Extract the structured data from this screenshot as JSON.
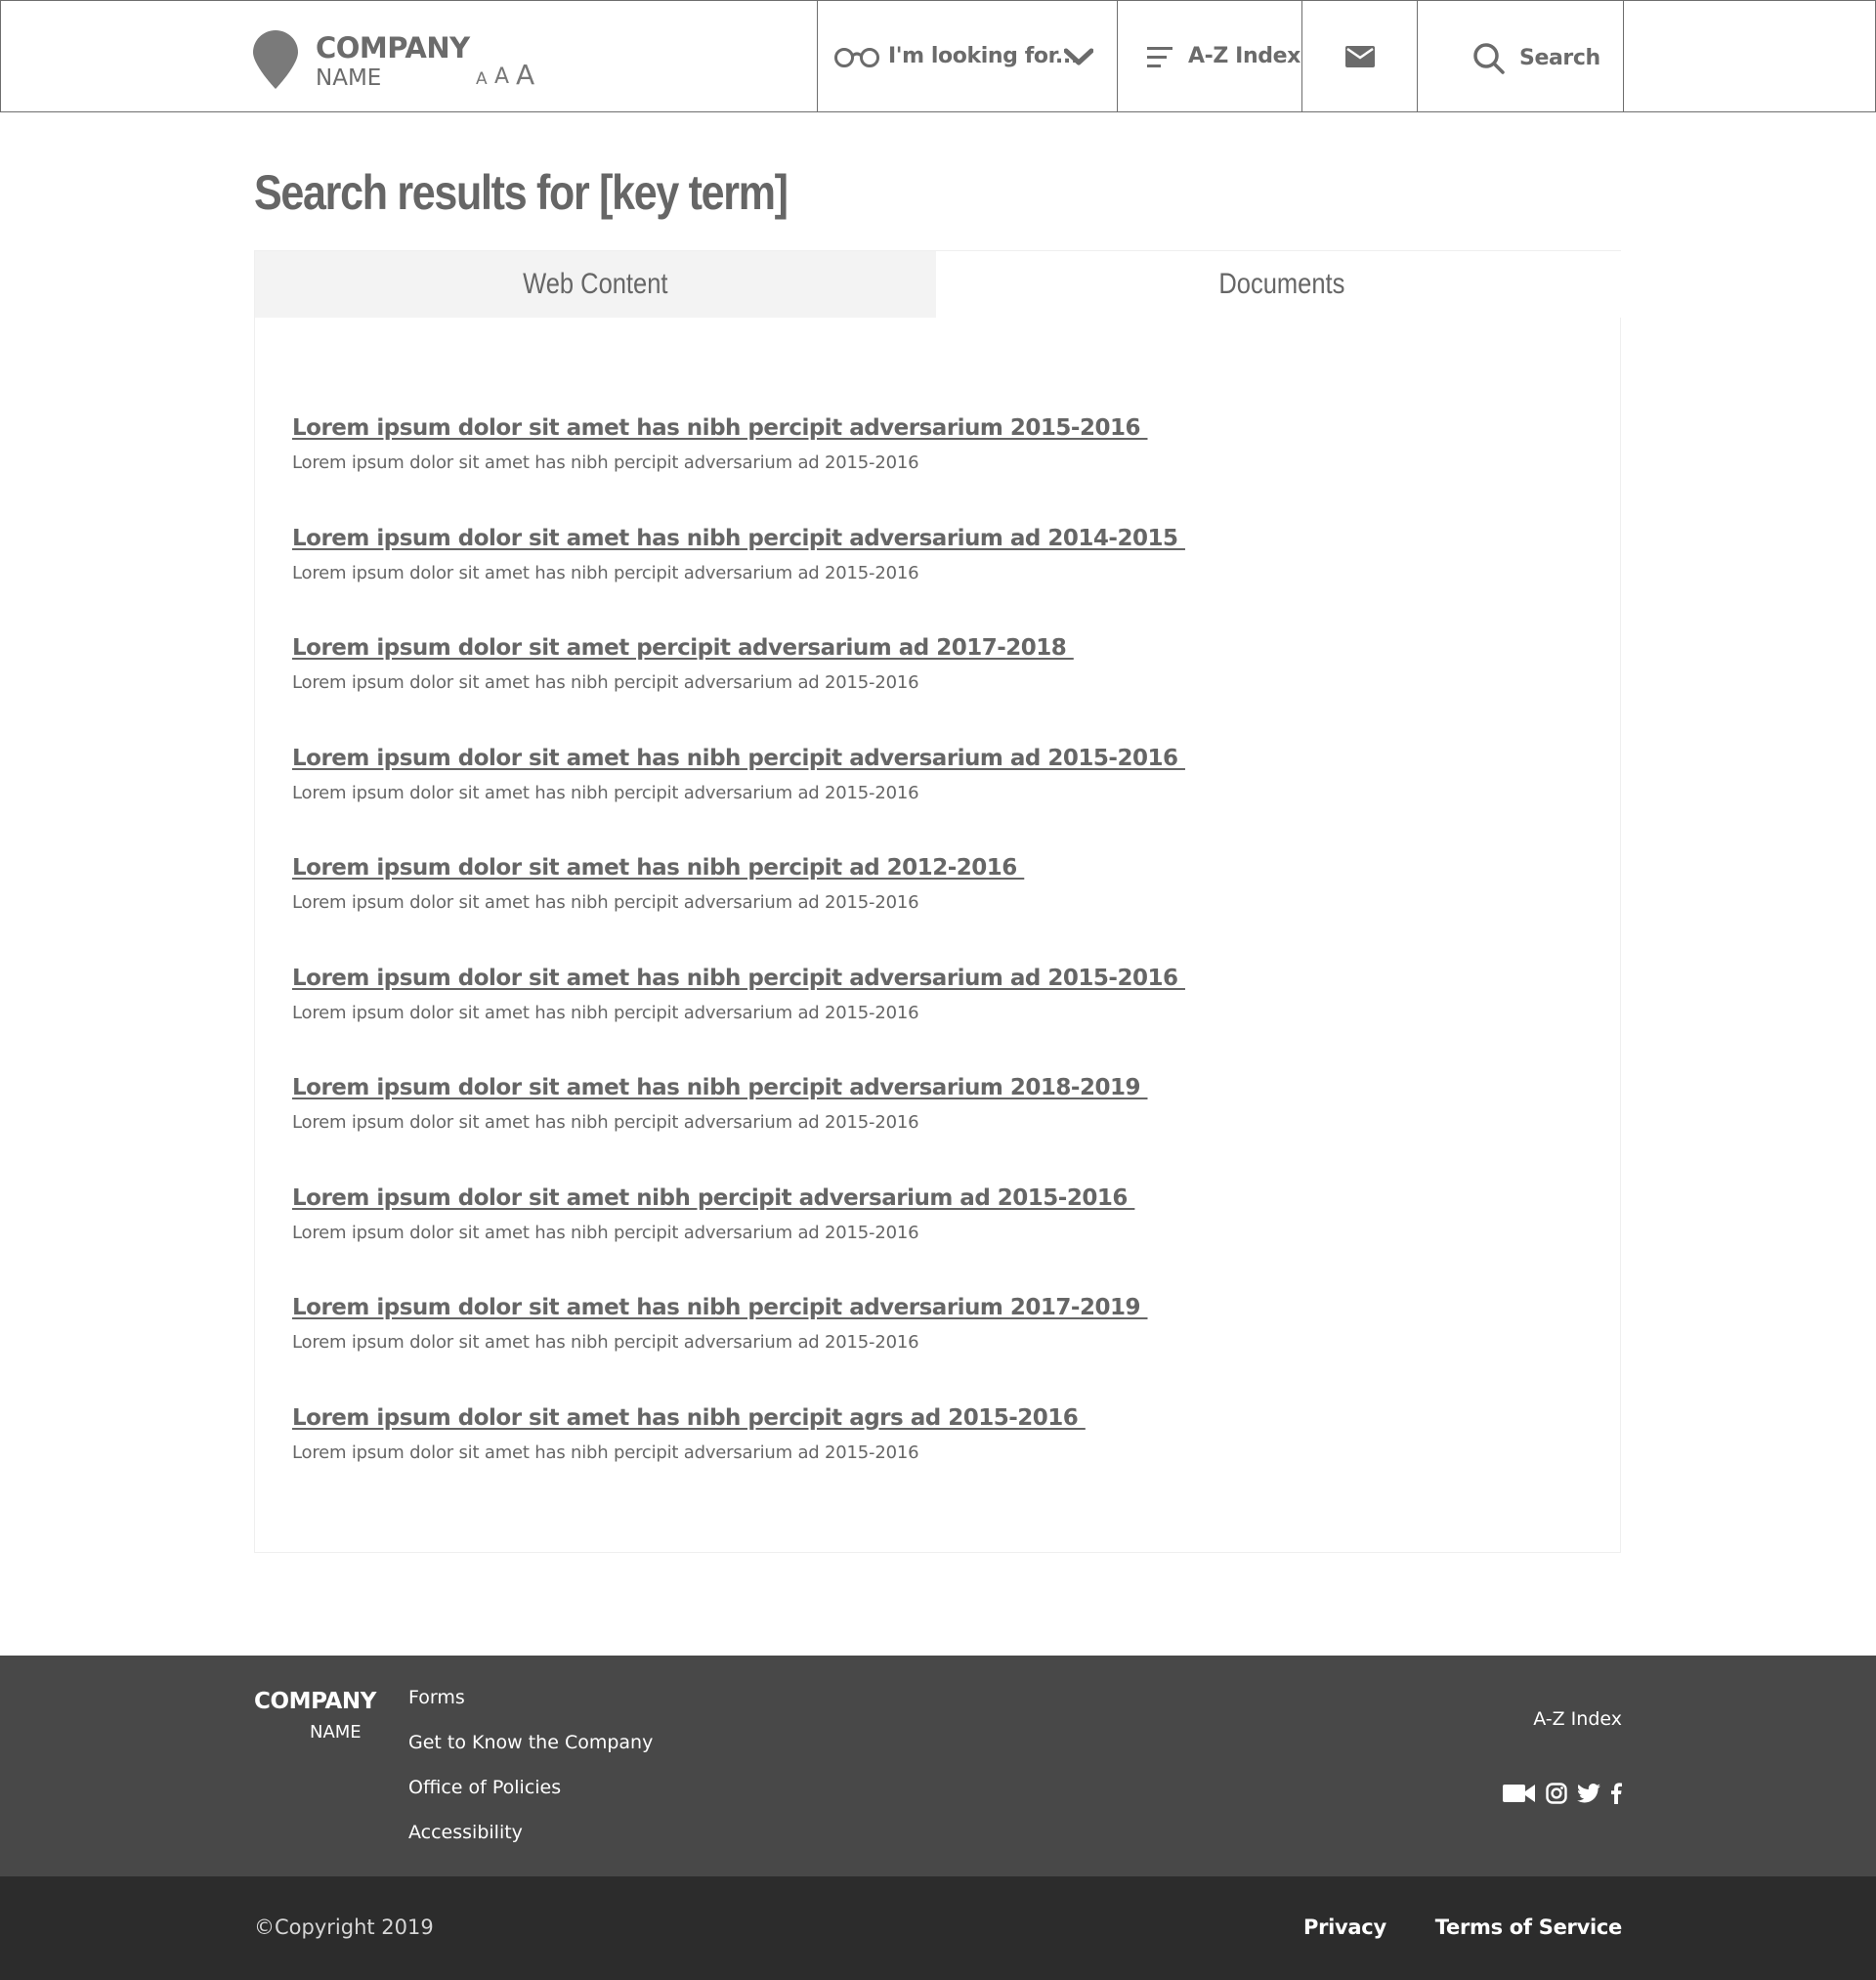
{
  "header": {
    "logo": {
      "company": "COMPANY",
      "name": "NAME"
    },
    "text_size": {
      "small": "A",
      "medium": "A",
      "large": "A"
    },
    "looking_for": {
      "label": "I'm looking for...",
      "icon": "glasses-icon"
    },
    "az_index": {
      "label": "A-Z Index",
      "icon": "menu-lines-icon"
    },
    "mail": {
      "icon": "envelope-icon"
    },
    "search": {
      "label": "Search",
      "icon": "search-icon"
    }
  },
  "main": {
    "title": "Search results for [key term]",
    "tabs": [
      {
        "label": "Web Content",
        "active": false
      },
      {
        "label": "Documents",
        "active": true
      }
    ],
    "results": [
      {
        "title": "Lorem ipsum dolor sit amet has nibh percipit adversarium 2015-2016 ",
        "description": "Lorem ipsum dolor sit amet has nibh percipit adversarium ad 2015-2016"
      },
      {
        "title": "Lorem ipsum dolor sit amet has nibh percipit adversarium ad 2014-2015 ",
        "description": "Lorem ipsum dolor sit amet has nibh percipit adversarium ad 2015-2016"
      },
      {
        "title": "Lorem ipsum dolor sit amet percipit adversarium ad 2017-2018 ",
        "description": "Lorem ipsum dolor sit amet has nibh percipit adversarium ad 2015-2016"
      },
      {
        "title": "Lorem ipsum dolor sit amet has nibh percipit adversarium ad 2015-2016 ",
        "description": "Lorem ipsum dolor sit amet has nibh percipit adversarium ad 2015-2016"
      },
      {
        "title": "Lorem ipsum dolor sit amet has nibh percipit ad 2012-2016 ",
        "description": "Lorem ipsum dolor sit amet has nibh percipit adversarium ad 2015-2016"
      },
      {
        "title": "Lorem ipsum dolor sit amet has nibh percipit adversarium ad 2015-2016 ",
        "description": "Lorem ipsum dolor sit amet has nibh percipit adversarium ad 2015-2016"
      },
      {
        "title": "Lorem ipsum dolor sit amet has nibh percipit adversarium 2018-2019 ",
        "description": "Lorem ipsum dolor sit amet has nibh percipit adversarium ad 2015-2016"
      },
      {
        "title": "Lorem ipsum dolor sit amet nibh percipit adversarium ad 2015-2016 ",
        "description": "Lorem ipsum dolor sit amet has nibh percipit adversarium ad 2015-2016"
      },
      {
        "title": "Lorem ipsum dolor sit amet has nibh percipit adversarium 2017-2019 ",
        "description": "Lorem ipsum dolor sit amet has nibh percipit adversarium ad 2015-2016"
      },
      {
        "title": "Lorem ipsum dolor sit amet has nibh percipit agrs ad 2015-2016 ",
        "description": "Lorem ipsum dolor sit amet has nibh percipit adversarium ad 2015-2016"
      }
    ]
  },
  "footer": {
    "company": "COMPANY",
    "name": "NAME",
    "links": [
      "Forms",
      "Get to Know the Company",
      "Office of Policies",
      "Accessibility"
    ],
    "az_index": "A-Z Index",
    "socials": [
      "video-camera-icon",
      "instagram-icon",
      "twitter-icon",
      "facebook-icon"
    ]
  },
  "subfooter": {
    "copyright": "©Copyright 2019",
    "privacy": "Privacy",
    "terms": "Terms of Service"
  },
  "colors": {
    "text": "#666666",
    "border": "#6e6e6e",
    "tab_inactive_bg": "#f3f3f3",
    "footer_bg": "#484848",
    "subfooter_bg": "#2c2c2c"
  }
}
